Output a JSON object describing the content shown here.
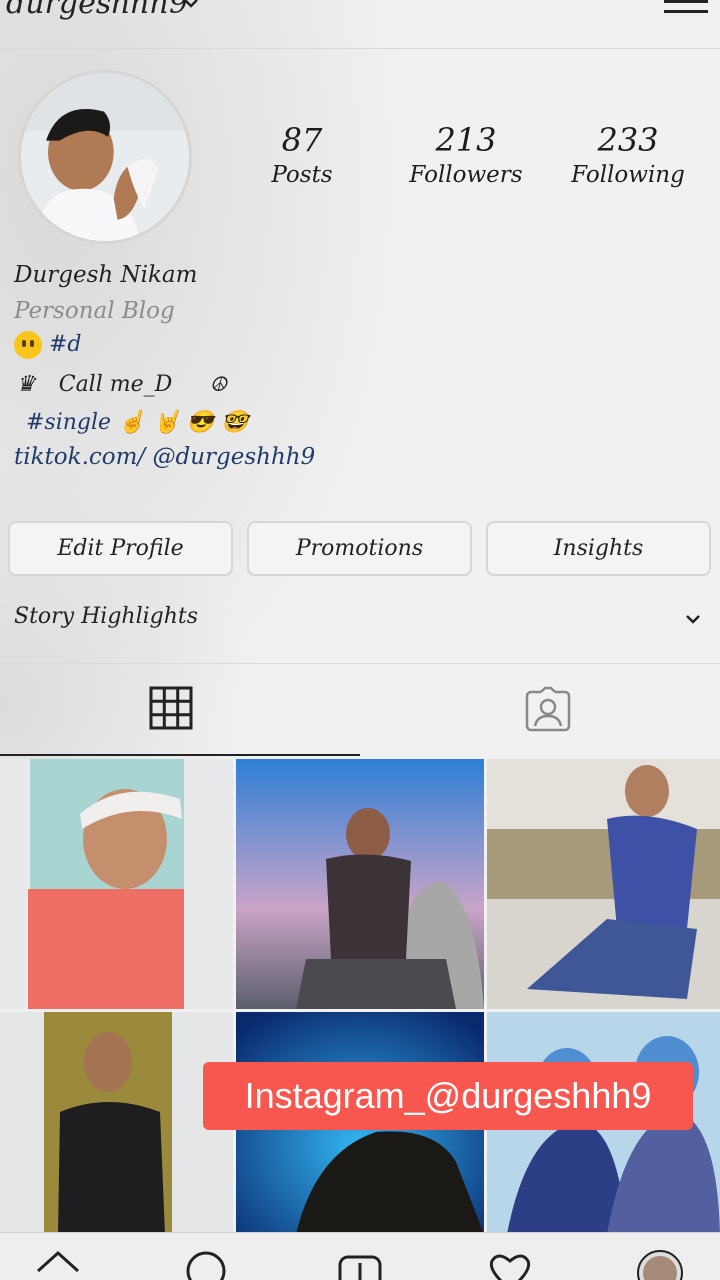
{
  "header": {
    "username": "durgeshhh9",
    "username_icon": "chevron-down-icon",
    "menu_icon": "hamburger-menu-icon"
  },
  "profile": {
    "avatar_icon": "profile-avatar",
    "stats": [
      {
        "value": "87",
        "label": "Posts"
      },
      {
        "value": "213",
        "label": "Followers"
      },
      {
        "value": "233",
        "label": "Following"
      }
    ],
    "name": "Durgesh Nikam",
    "category": "Personal Blog",
    "bio_line1": "#d",
    "bio_line2_prefix": "♛",
    "bio_line2": "Call me_D",
    "bio_line2_suffix": "☮",
    "bio_line3": "#single ☝ 🤘 😎 🤓",
    "link": "tiktok.com/ @durgeshhh9"
  },
  "actions": {
    "edit_profile": "Edit Profile",
    "promotions": "Promotions",
    "insights": "Insights"
  },
  "highlights": {
    "label": "Story Highlights"
  },
  "tabs": [
    {
      "icon": "grid-icon",
      "active": true
    },
    {
      "icon": "tagged-person-icon",
      "active": false
    }
  ],
  "watermark": "Instagram_@durgeshhh9",
  "nav": [
    "home-icon",
    "search-icon",
    "add-post-icon",
    "heart-icon",
    "profile-icon"
  ],
  "colors": {
    "link": "#1f3c6b",
    "watermark_bg": "#f7574f",
    "muted": "#8c8c8c"
  }
}
